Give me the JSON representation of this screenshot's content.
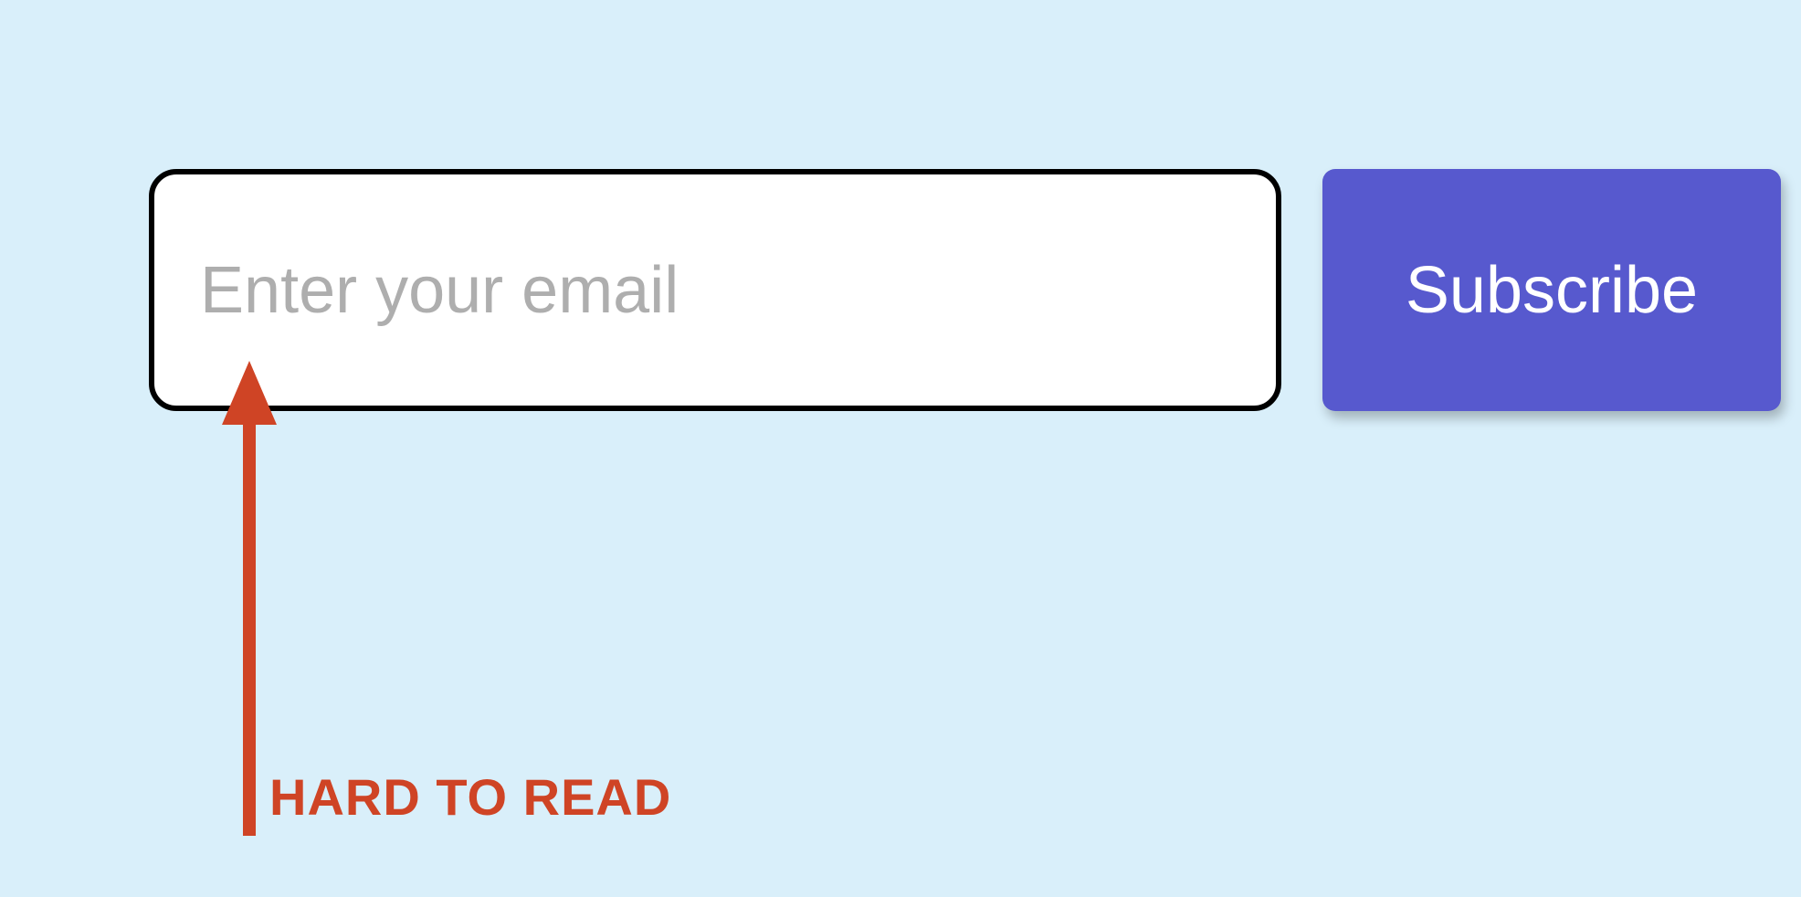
{
  "form": {
    "email_placeholder": "Enter your email",
    "subscribe_label": "Subscribe"
  },
  "annotation": {
    "label": "HARD TO READ",
    "color": "#cf4425"
  },
  "colors": {
    "background": "#d9effa",
    "button": "#5759ce",
    "button_text": "#ffffff",
    "placeholder": "#aeaeae",
    "input_border": "#000000",
    "annotation": "#cf4425"
  }
}
